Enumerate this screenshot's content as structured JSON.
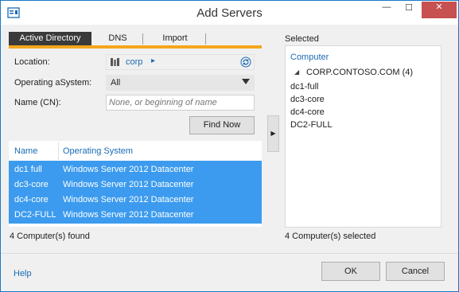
{
  "window": {
    "title": "Add Servers",
    "minimize_glyph": "—",
    "maximize_glyph": "☐",
    "close_glyph": "✕"
  },
  "tabs": [
    {
      "label": "Active Directory",
      "active": true
    },
    {
      "label": "DNS",
      "active": false
    },
    {
      "label": "Import",
      "active": false
    }
  ],
  "form": {
    "location_label": "Location:",
    "location_value": "corp",
    "location_arrow": "▸",
    "os_label": "Operating aSystem:",
    "os_value": "All",
    "name_label": "Name (CN):",
    "name_placeholder": "None, or beginning of name",
    "find_now": "Find Now"
  },
  "results": {
    "columns": [
      "Name",
      "Operating System"
    ],
    "rows": [
      {
        "name": "dc1 full",
        "os": "Windows Server 2012 Datacenter"
      },
      {
        "name": "dc3-core",
        "os": "Windows Server 2012 Datacenter"
      },
      {
        "name": "dc4-core",
        "os": "Windows Server 2012 Datacenter"
      },
      {
        "name": "DC2-FULL",
        "os": "Windows Server 2012 Datacenter"
      }
    ],
    "status": "4 Computer(s) found"
  },
  "add_arrow": "▶",
  "selected": {
    "label": "Selected",
    "column": "Computer",
    "group_caret": "◢",
    "group": "CORP.CONTOSO.COM (4)",
    "items": [
      "dc1-full",
      "dc3-core",
      "dc4-core",
      "DC2-FULL"
    ],
    "status": "4 Computer(s) selected"
  },
  "footer": {
    "help": "Help",
    "ok": "OK",
    "cancel": "Cancel"
  },
  "colors": {
    "accent": "#1a6bb5",
    "selection": "#3c9bee",
    "tab_rule": "#f4a71d",
    "close": "#c75050"
  },
  "icons": {
    "app": "server-manager-icon",
    "location": "domain-icon",
    "refresh": "refresh-icon"
  }
}
